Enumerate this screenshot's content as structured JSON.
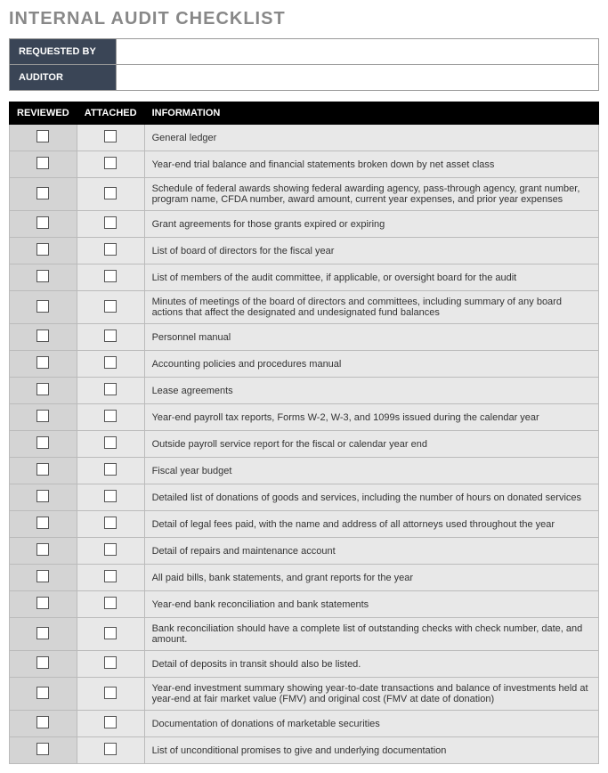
{
  "title": "INTERNAL AUDIT CHECKLIST",
  "header": {
    "requested_by_label": "REQUESTED BY",
    "requested_by_value": "",
    "auditor_label": "AUDITOR",
    "auditor_value": ""
  },
  "columns": {
    "reviewed": "REVIEWED",
    "attached": "ATTACHED",
    "information": "INFORMATION"
  },
  "rows": [
    {
      "info": "General ledger"
    },
    {
      "info": "Year-end trial balance and financial statements broken down by net asset class"
    },
    {
      "info": "Schedule of federal awards showing federal awarding agency, pass-through agency, grant number, program name, CFDA number, award amount, current year expenses, and prior year expenses"
    },
    {
      "info": "Grant agreements for those grants expired or expiring"
    },
    {
      "info": "List of board of directors for the fiscal year"
    },
    {
      "info": "List of members of the audit committee, if applicable, or oversight board for the audit"
    },
    {
      "info": "Minutes of meetings of the board of directors and committees, including summary of any board actions that affect the designated and undesignated fund balances"
    },
    {
      "info": "Personnel manual"
    },
    {
      "info": "Accounting policies and procedures manual"
    },
    {
      "info": "Lease agreements"
    },
    {
      "info": "Year-end payroll tax reports, Forms W-2, W-3, and 1099s issued during the calendar year"
    },
    {
      "info": "Outside payroll service report for the fiscal or calendar year end"
    },
    {
      "info": "Fiscal year budget"
    },
    {
      "info": "Detailed list of donations of goods and services, including the number of hours on donated services"
    },
    {
      "info": "Detail of legal fees paid, with the name and address of all attorneys used throughout the year"
    },
    {
      "info": "Detail of repairs and maintenance account"
    },
    {
      "info": "All paid bills, bank statements, and grant reports for the year"
    },
    {
      "info": "Year-end bank reconciliation and bank statements"
    },
    {
      "info": "Bank reconciliation should have a complete list of outstanding checks with check number, date, and amount."
    },
    {
      "info": "Detail of deposits in transit should also be listed."
    },
    {
      "info": "Year-end investment summary showing year-to-date transactions and balance of investments held at year-end at fair market value (FMV) and original cost (FMV at date of donation)"
    },
    {
      "info": "Documentation of donations of marketable securities"
    },
    {
      "info": "List of unconditional promises to give and underlying documentation"
    }
  ]
}
